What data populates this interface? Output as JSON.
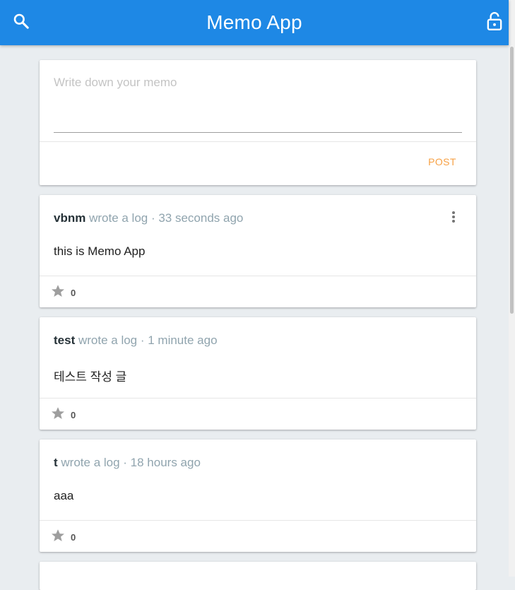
{
  "app": {
    "title": "Memo App",
    "accent_color": "#1e88e5",
    "icons": {
      "search": "search-icon",
      "lock": "lock-open-icon",
      "more": "more-vert-icon",
      "star": "star-icon"
    }
  },
  "writer": {
    "placeholder": "Write down your memo",
    "value": "",
    "post_label": "POST",
    "post_color": "#f7a145"
  },
  "memos": [
    {
      "username": "vbnm",
      "meta": "wrote a log · 33 seconds ago",
      "contents": "this is Memo App",
      "stars": "0",
      "has_menu": true
    },
    {
      "username": "test",
      "meta": "wrote a log · 1 minute ago",
      "contents": "테스트 작성 글",
      "stars": "0",
      "has_menu": false
    },
    {
      "username": "t",
      "meta": "wrote a log · 18 hours ago",
      "contents": "aaa",
      "stars": "0",
      "has_menu": false
    }
  ]
}
